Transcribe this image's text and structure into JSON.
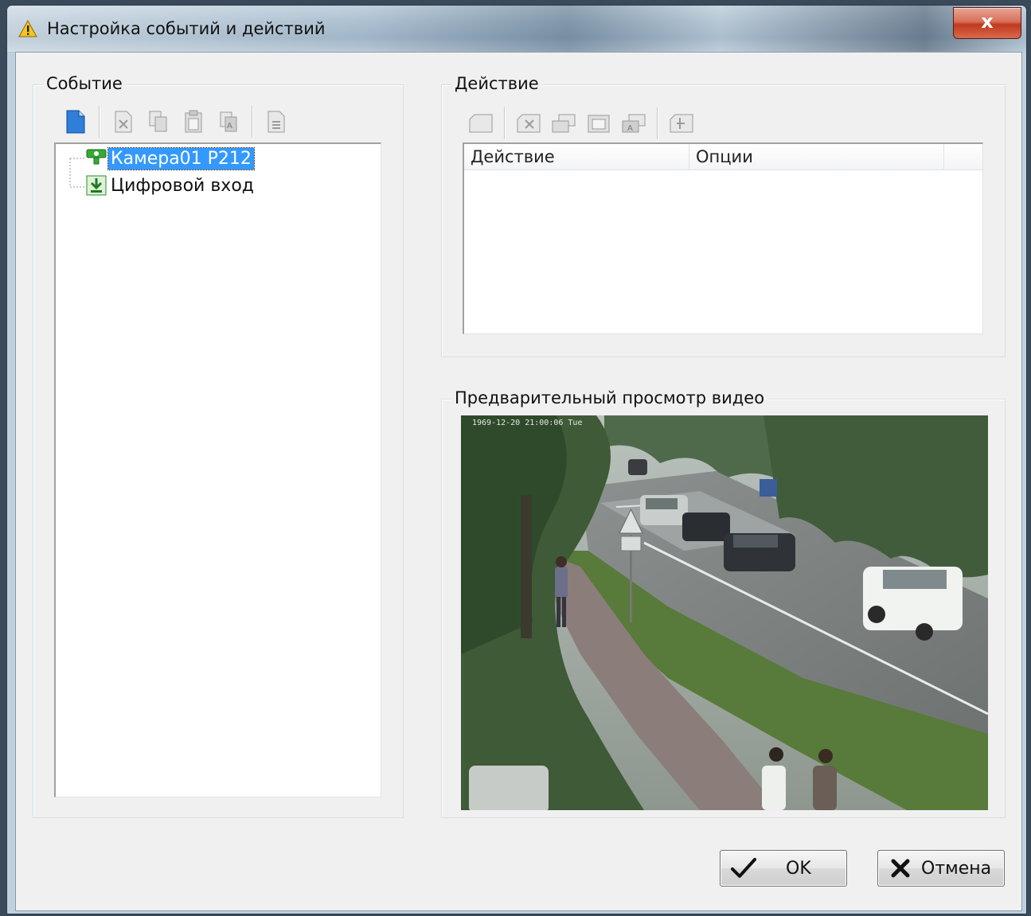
{
  "window": {
    "title": "Настройка событий и действий",
    "close_label": "x"
  },
  "event_group": {
    "legend": "Событие",
    "toolbar": [
      "new-event-icon",
      "delete-event-icon",
      "copy-event-icon",
      "paste-event-icon",
      "rename-event-icon",
      "properties-event-icon"
    ],
    "tree": [
      {
        "label": "Камера01 P212",
        "icon": "camera-motion-icon",
        "selected": true
      },
      {
        "label": "Цифровой вход",
        "icon": "digital-input-icon",
        "selected": false
      }
    ]
  },
  "action_group": {
    "legend": "Действие",
    "toolbar": [
      "new-action-icon",
      "delete-action-icon",
      "copy-action-icon",
      "paste-action-icon",
      "rename-action-icon",
      "properties-action-icon"
    ],
    "columns": [
      "Действие",
      "Опции"
    ]
  },
  "preview_group": {
    "legend": "Предварительный просмотр видео",
    "osd": "1969-12-20 21:00:06 Tue"
  },
  "buttons": {
    "ok": "OK",
    "cancel": "Отмена"
  },
  "colors": {
    "selection": "#3399ff",
    "close_red": "#c0391f",
    "dialog_bg": "#f0f0f0"
  }
}
